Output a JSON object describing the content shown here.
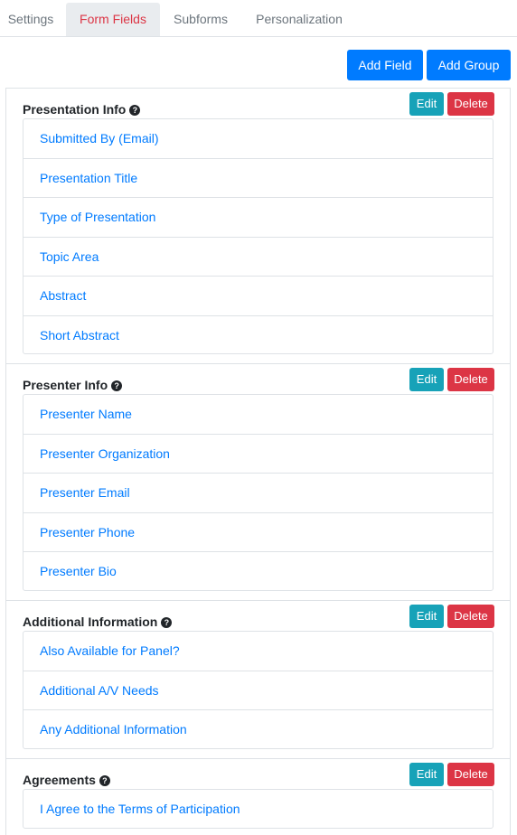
{
  "tabs": [
    {
      "label": "Settings"
    },
    {
      "label": "Form Fields"
    },
    {
      "label": "Subforms"
    },
    {
      "label": "Personalization"
    }
  ],
  "actions": {
    "add_field": "Add Field",
    "add_group": "Add Group"
  },
  "groups": [
    {
      "title": "Presentation Info",
      "edit": "Edit",
      "delete": "Delete",
      "fields": [
        "Submitted By (Email)",
        "Presentation Title",
        "Type of Presentation",
        "Topic Area",
        "Abstract",
        "Short Abstract"
      ]
    },
    {
      "title": "Presenter Info",
      "edit": "Edit",
      "delete": "Delete",
      "fields": [
        "Presenter Name",
        "Presenter Organization",
        "Presenter Email",
        "Presenter Phone",
        "Presenter Bio"
      ]
    },
    {
      "title": "Additional Information",
      "edit": "Edit",
      "delete": "Delete",
      "fields": [
        "Also Available for Panel?",
        "Additional A/V Needs",
        "Any Additional Information"
      ]
    },
    {
      "title": "Agreements",
      "edit": "Edit",
      "delete": "Delete",
      "fields": [
        "I Agree to the Terms of Participation"
      ]
    }
  ],
  "colors": {
    "accent": "#007bff",
    "active_tab": "#dc3545",
    "edit": "#17a2b8",
    "delete": "#dc3545"
  }
}
